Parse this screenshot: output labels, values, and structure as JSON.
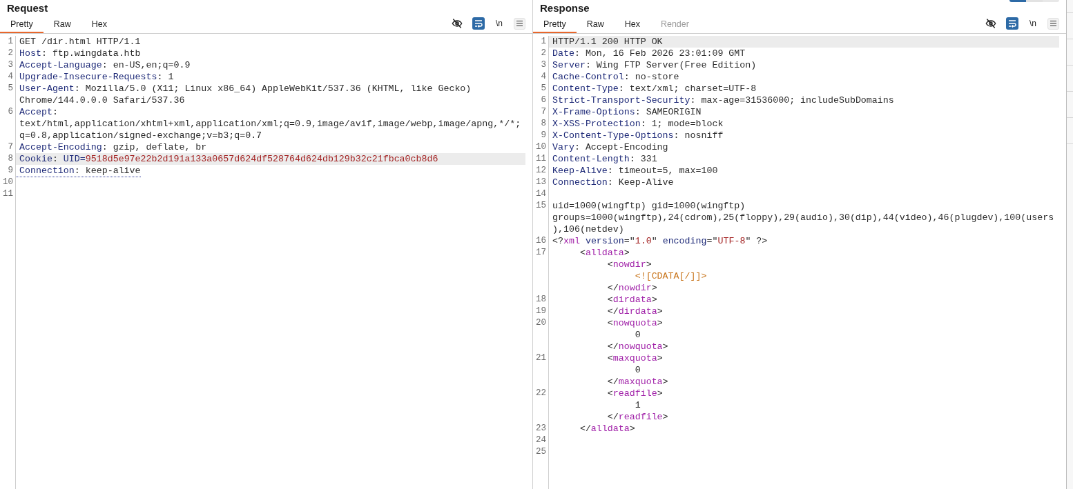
{
  "panes": [
    {
      "title": "Request",
      "tabs": [
        {
          "label": "Pretty",
          "selected": true,
          "disabled": false
        },
        {
          "label": "Raw",
          "selected": false,
          "disabled": false
        },
        {
          "label": "Hex",
          "selected": false,
          "disabled": false
        }
      ],
      "toolbar": {
        "wrap_on": true,
        "newline_label": "\\n"
      },
      "lines": [
        {
          "num": "1",
          "highlighted": false,
          "underlined": false,
          "segments": [
            {
              "kind": "plain",
              "text": "GET /dir.html HTTP/1.1"
            }
          ]
        },
        {
          "num": "2",
          "highlighted": false,
          "underlined": false,
          "segments": [
            {
              "kind": "name",
              "text": "Host"
            },
            {
              "kind": "plain",
              "text": ": ftp.wingdata.htb"
            }
          ]
        },
        {
          "num": "3",
          "highlighted": false,
          "underlined": false,
          "segments": [
            {
              "kind": "name",
              "text": "Accept-Language"
            },
            {
              "kind": "plain",
              "text": ": en-US,en;q=0.9"
            }
          ]
        },
        {
          "num": "4",
          "highlighted": false,
          "underlined": false,
          "segments": [
            {
              "kind": "name",
              "text": "Upgrade-Insecure-Requests"
            },
            {
              "kind": "plain",
              "text": ": 1"
            }
          ]
        },
        {
          "num": "5",
          "highlighted": false,
          "underlined": false,
          "segments": [
            {
              "kind": "name",
              "text": "User-Agent"
            },
            {
              "kind": "plain",
              "text": ": Mozilla/5.0 (X11; Linux x86_64) AppleWebKit/537.36 (KHTML, like Gecko)"
            },
            {
              "kind": "break"
            },
            {
              "kind": "plain",
              "text": "Chrome/144.0.0.0 Safari/537.36"
            }
          ]
        },
        {
          "num": "6",
          "highlighted": false,
          "underlined": false,
          "segments": [
            {
              "kind": "name",
              "text": "Accept"
            },
            {
              "kind": "plain",
              "text": ":"
            },
            {
              "kind": "break"
            },
            {
              "kind": "plain",
              "text": "text/html,application/xhtml+xml,application/xml;q=0.9,image/avif,image/webp,image/apng,*/*;"
            },
            {
              "kind": "break"
            },
            {
              "kind": "plain",
              "text": "q=0.8,application/signed-exchange;v=b3;q=0.7"
            }
          ]
        },
        {
          "num": "7",
          "highlighted": false,
          "underlined": false,
          "segments": [
            {
              "kind": "name",
              "text": "Accept-Encoding"
            },
            {
              "kind": "plain",
              "text": ": gzip, deflate, br"
            }
          ]
        },
        {
          "num": "8",
          "highlighted": true,
          "underlined": false,
          "segments": [
            {
              "kind": "name",
              "text": "Cookie"
            },
            {
              "kind": "plain",
              "text": ": "
            },
            {
              "kind": "name",
              "text": "UID="
            },
            {
              "kind": "string",
              "text": "9518d5e97e22b2d191a133a0657d624df528764d624db129b32c21fbca0cb8d6"
            }
          ]
        },
        {
          "num": "9",
          "highlighted": false,
          "underlined": true,
          "segments": [
            {
              "kind": "name",
              "text": "Connection"
            },
            {
              "kind": "plain",
              "text": ": keep-alive"
            }
          ]
        },
        {
          "num": "10",
          "highlighted": false,
          "underlined": false
        },
        {
          "num": "11",
          "highlighted": false,
          "underlined": false
        }
      ]
    },
    {
      "title": "Response",
      "tabs": [
        {
          "label": "Pretty",
          "selected": true,
          "disabled": false
        },
        {
          "label": "Raw",
          "selected": false,
          "disabled": false
        },
        {
          "label": "Hex",
          "selected": false,
          "disabled": false
        },
        {
          "label": "Render",
          "selected": false,
          "disabled": true
        }
      ],
      "toolbar": {
        "wrap_on": true,
        "newline_label": "\\n"
      },
      "lines": [
        {
          "num": "1",
          "highlighted": true,
          "underlined": false,
          "segments": [
            {
              "kind": "plain",
              "text": "HTTP/1.1 200 HTTP OK"
            }
          ]
        },
        {
          "num": "2",
          "highlighted": false,
          "underlined": false,
          "segments": [
            {
              "kind": "name",
              "text": "Date"
            },
            {
              "kind": "plain",
              "text": ": Mon, 16 Feb 2026 23:01:09 GMT"
            }
          ]
        },
        {
          "num": "3",
          "highlighted": false,
          "underlined": false,
          "segments": [
            {
              "kind": "name",
              "text": "Server"
            },
            {
              "kind": "plain",
              "text": ": Wing FTP Server(Free Edition)"
            }
          ]
        },
        {
          "num": "4",
          "highlighted": false,
          "underlined": false,
          "segments": [
            {
              "kind": "name",
              "text": "Cache-Control"
            },
            {
              "kind": "plain",
              "text": ": no-store"
            }
          ]
        },
        {
          "num": "5",
          "highlighted": false,
          "underlined": false,
          "segments": [
            {
              "kind": "name",
              "text": "Content-Type"
            },
            {
              "kind": "plain",
              "text": ": text/xml; charset=UTF-8"
            }
          ]
        },
        {
          "num": "6",
          "highlighted": false,
          "underlined": false,
          "segments": [
            {
              "kind": "name",
              "text": "Strict-Transport-Security"
            },
            {
              "kind": "plain",
              "text": ": max-age=31536000; includeSubDomains"
            }
          ]
        },
        {
          "num": "7",
          "highlighted": false,
          "underlined": false,
          "segments": [
            {
              "kind": "name",
              "text": "X-Frame-Options"
            },
            {
              "kind": "plain",
              "text": ": SAMEORIGIN"
            }
          ]
        },
        {
          "num": "8",
          "highlighted": false,
          "underlined": false,
          "segments": [
            {
              "kind": "name",
              "text": "X-XSS-Protection"
            },
            {
              "kind": "plain",
              "text": ": 1; mode=block"
            }
          ]
        },
        {
          "num": "9",
          "highlighted": false,
          "underlined": false,
          "segments": [
            {
              "kind": "name",
              "text": "X-Content-Type-Options"
            },
            {
              "kind": "plain",
              "text": ": nosniff"
            }
          ]
        },
        {
          "num": "10",
          "highlighted": false,
          "underlined": false,
          "segments": [
            {
              "kind": "name",
              "text": "Vary"
            },
            {
              "kind": "plain",
              "text": ": Accept-Encoding"
            }
          ]
        },
        {
          "num": "11",
          "highlighted": false,
          "underlined": false,
          "segments": [
            {
              "kind": "name",
              "text": "Content-Length"
            },
            {
              "kind": "plain",
              "text": ": 331"
            }
          ]
        },
        {
          "num": "12",
          "highlighted": false,
          "underlined": false,
          "segments": [
            {
              "kind": "name",
              "text": "Keep-Alive"
            },
            {
              "kind": "plain",
              "text": ": timeout=5, max=100"
            }
          ]
        },
        {
          "num": "13",
          "highlighted": false,
          "underlined": false,
          "segments": [
            {
              "kind": "name",
              "text": "Connection"
            },
            {
              "kind": "plain",
              "text": ": Keep-Alive"
            }
          ]
        },
        {
          "num": "14",
          "highlighted": false,
          "underlined": false
        },
        {
          "num": "15",
          "highlighted": false,
          "underlined": false,
          "segments": [
            {
              "kind": "plain",
              "text": "uid=1000(wingftp) gid=1000(wingftp)"
            },
            {
              "kind": "break"
            },
            {
              "kind": "plain",
              "text": "groups=1000(wingftp),24(cdrom),25(floppy),29(audio),30(dip),44(video),46(plugdev),100(users"
            },
            {
              "kind": "break"
            },
            {
              "kind": "plain",
              "text": "),106(netdev)"
            }
          ]
        },
        {
          "num": "16",
          "highlighted": false,
          "underlined": false,
          "segments": [
            {
              "kind": "plain",
              "text": "<?"
            },
            {
              "kind": "tag",
              "text": "xml"
            },
            {
              "kind": "name",
              "text": " version"
            },
            {
              "kind": "plain",
              "text": "=\""
            },
            {
              "kind": "string",
              "text": "1.0"
            },
            {
              "kind": "plain",
              "text": "\""
            },
            {
              "kind": "name",
              "text": " encoding"
            },
            {
              "kind": "plain",
              "text": "=\""
            },
            {
              "kind": "string",
              "text": "UTF-8"
            },
            {
              "kind": "plain",
              "text": "\" ?>"
            }
          ]
        },
        {
          "num": "17",
          "highlighted": false,
          "underlined": false,
          "segments": [
            {
              "kind": "plain",
              "text": "     <"
            },
            {
              "kind": "tag",
              "text": "alldata"
            },
            {
              "kind": "plain",
              "text": ">"
            },
            {
              "kind": "break"
            },
            {
              "kind": "plain",
              "text": "          <"
            },
            {
              "kind": "tag",
              "text": "nowdir"
            },
            {
              "kind": "plain",
              "text": ">"
            },
            {
              "kind": "break"
            },
            {
              "kind": "cdata",
              "text": "               <![CDATA[/]]>"
            },
            {
              "kind": "break"
            },
            {
              "kind": "plain",
              "text": "          </"
            },
            {
              "kind": "tag",
              "text": "nowdir"
            },
            {
              "kind": "plain",
              "text": ">"
            }
          ]
        },
        {
          "num": "18",
          "highlighted": false,
          "underlined": false,
          "segments": [
            {
              "kind": "plain",
              "text": "          <"
            },
            {
              "kind": "tag",
              "text": "dirdata"
            },
            {
              "kind": "plain",
              "text": ">"
            }
          ]
        },
        {
          "num": "19",
          "highlighted": false,
          "underlined": false,
          "segments": [
            {
              "kind": "plain",
              "text": "          </"
            },
            {
              "kind": "tag",
              "text": "dirdata"
            },
            {
              "kind": "plain",
              "text": ">"
            }
          ]
        },
        {
          "num": "20",
          "highlighted": false,
          "underlined": false,
          "segments": [
            {
              "kind": "plain",
              "text": "          <"
            },
            {
              "kind": "tag",
              "text": "nowquota"
            },
            {
              "kind": "plain",
              "text": ">"
            },
            {
              "kind": "break"
            },
            {
              "kind": "plain",
              "text": "               0"
            },
            {
              "kind": "break"
            },
            {
              "kind": "plain",
              "text": "          </"
            },
            {
              "kind": "tag",
              "text": "nowquota"
            },
            {
              "kind": "plain",
              "text": ">"
            }
          ]
        },
        {
          "num": "21",
          "highlighted": false,
          "underlined": false,
          "segments": [
            {
              "kind": "plain",
              "text": "          <"
            },
            {
              "kind": "tag",
              "text": "maxquota"
            },
            {
              "kind": "plain",
              "text": ">"
            },
            {
              "kind": "break"
            },
            {
              "kind": "plain",
              "text": "               0"
            },
            {
              "kind": "break"
            },
            {
              "kind": "plain",
              "text": "          </"
            },
            {
              "kind": "tag",
              "text": "maxquota"
            },
            {
              "kind": "plain",
              "text": ">"
            }
          ]
        },
        {
          "num": "22",
          "highlighted": false,
          "underlined": false,
          "segments": [
            {
              "kind": "plain",
              "text": "          <"
            },
            {
              "kind": "tag",
              "text": "readfile"
            },
            {
              "kind": "plain",
              "text": ">"
            },
            {
              "kind": "break"
            },
            {
              "kind": "plain",
              "text": "               1"
            },
            {
              "kind": "break"
            },
            {
              "kind": "plain",
              "text": "          </"
            },
            {
              "kind": "tag",
              "text": "readfile"
            },
            {
              "kind": "plain",
              "text": ">"
            }
          ]
        },
        {
          "num": "23",
          "highlighted": false,
          "underlined": false,
          "segments": [
            {
              "kind": "plain",
              "text": "     </"
            },
            {
              "kind": "tag",
              "text": "alldata"
            },
            {
              "kind": "plain",
              "text": ">"
            }
          ]
        },
        {
          "num": "24",
          "highlighted": false,
          "underlined": false
        },
        {
          "num": "25",
          "highlighted": false,
          "underlined": false
        }
      ]
    }
  ]
}
